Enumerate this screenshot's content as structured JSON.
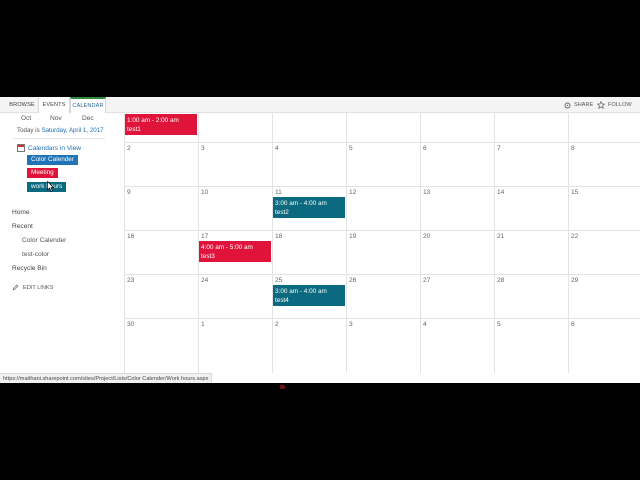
{
  "ribbon": {
    "tabs": [
      "BROWSE",
      "EVENTS",
      "CALENDAR"
    ],
    "share_label": "SHARE",
    "follow_label": "FOLLOW"
  },
  "leftnav": {
    "months": [
      "Oct",
      "Nov",
      "Dec"
    ],
    "today_prefix": "Today is",
    "today_date": "Saturday, April 1, 2017",
    "calendars_in_view": "Calendars in View",
    "calendars": [
      {
        "label": "Color Calender",
        "color": "#1f73b7"
      },
      {
        "label": "Meeting",
        "color": "#e0143a"
      },
      {
        "label": "work hours",
        "color": "#0b6a7f"
      }
    ],
    "links": {
      "home": "Home",
      "recent": "Recent",
      "recent_items": [
        "Color Calender",
        "test-color"
      ],
      "recycle": "Recycle Bin"
    },
    "edit_links": "EDIT LINKS"
  },
  "calendar": {
    "weeks": [
      [
        "",
        "",
        "",
        "",
        "",
        "",
        ""
      ],
      [
        "2",
        "3",
        "4",
        "5",
        "6",
        "7",
        "8"
      ],
      [
        "9",
        "10",
        "11",
        "12",
        "13",
        "14",
        "15"
      ],
      [
        "16",
        "17",
        "18",
        "19",
        "20",
        "21",
        "22"
      ],
      [
        "23",
        "24",
        "25",
        "26",
        "27",
        "28",
        "29"
      ],
      [
        "30",
        "1",
        "2",
        "3",
        "4",
        "5",
        "6"
      ]
    ],
    "events": [
      {
        "time": "1:00 am - 2:00 am",
        "title": "test1",
        "color": "#e0143a"
      },
      {
        "time": "3:00 am - 4:00 am",
        "title": "test2",
        "color": "#0b6a7f"
      },
      {
        "time": "4:00 am - 5:00 am",
        "title": "test3",
        "color": "#e0143a"
      },
      {
        "time": "3:00 am - 4:00 am",
        "title": "test4",
        "color": "#0b6a7f"
      }
    ]
  },
  "status_url": "https://maithani.sharepoint.com/sites/Project/Lists/Color Calender/Work hours.aspx"
}
